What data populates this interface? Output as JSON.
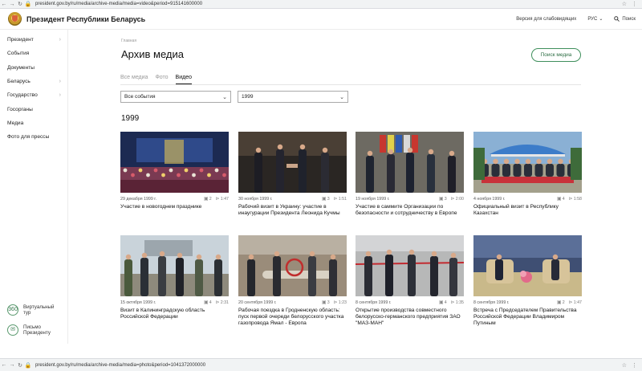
{
  "browser": {
    "top_url": "president.gov.by/ru/media/archive-media/media=video&period=915141600000",
    "bottom_url": "president.gov.by/ru/media/archive-media/media=photo&period=1041372000000"
  },
  "header": {
    "site_title": "Президент Республики Беларусь",
    "accessibility_label": "Версия для слабовидящих",
    "lang_label": "РУС",
    "search_label": "Поиск"
  },
  "sidebar": {
    "items": [
      {
        "label": "Президент",
        "has_children": true
      },
      {
        "label": "События",
        "has_children": false
      },
      {
        "label": "Документы",
        "has_children": false
      },
      {
        "label": "Беларусь",
        "has_children": true
      },
      {
        "label": "Государство",
        "has_children": true
      },
      {
        "label": "Госорганы",
        "has_children": false
      },
      {
        "label": "Медиа",
        "has_children": false
      },
      {
        "label": "Фото для прессы",
        "has_children": false
      }
    ],
    "virtual_tour": "Виртуальный тур",
    "letter": "Письмо Президенту"
  },
  "main": {
    "breadcrumb": "Главная",
    "title": "Архив медиа",
    "search_media_label": "Поиск медиа",
    "tabs": [
      {
        "label": "Все медиа",
        "active": false
      },
      {
        "label": "Фото",
        "active": false
      },
      {
        "label": "Видео",
        "active": true
      }
    ],
    "event_select": "Все события",
    "year_select": "1999",
    "year_heading": "1999"
  },
  "cards": [
    {
      "date": "29 декабря 1999 г.",
      "photos": "2",
      "views": "1:47",
      "title": "Участие в новогоднем празднике",
      "scene": "stage"
    },
    {
      "date": "30 ноября 1999 г.",
      "photos": "3",
      "views": "1:51",
      "title": "Рабочий визит в Украину: участие в инаугурации Президента Леонида Кучмы",
      "scene": "handshake"
    },
    {
      "date": "19 ноября 1999 г.",
      "photos": "3",
      "views": "2:00",
      "title": "Участие в саммите Организации по безопасности и сотрудничеству в Европе",
      "scene": "summit"
    },
    {
      "date": "4 ноября 1999 г.",
      "photos": "4",
      "views": "1:58",
      "title": "Официальный визит в Республику Казахстан",
      "scene": "ceremony"
    },
    {
      "date": "15 октября 1999 г.",
      "photos": "4",
      "views": "2:31",
      "title": "Визит в Калининградскую область Российской Федерации",
      "scene": "outdoor"
    },
    {
      "date": "20 сентября 1999 г.",
      "photos": "3",
      "views": "1:23",
      "title": "Рабочая поездка в Гродненскую область: пуск первой очереди белорусского участка газопровода Ямал - Европа",
      "scene": "valve"
    },
    {
      "date": "8 сентября 1999 г.",
      "photos": "4",
      "views": "1:35",
      "title": "Открытие производства совместного белорусско-германского предприятия ЗАО \"МАЗ-МАН\"",
      "scene": "ribbon"
    },
    {
      "date": "8 сентября 1999 г.",
      "photos": "2",
      "views": "1:47",
      "title": "Встреча с Председателем Правительства Российской Федерации Владимиром Путиным",
      "scene": "meeting"
    }
  ]
}
